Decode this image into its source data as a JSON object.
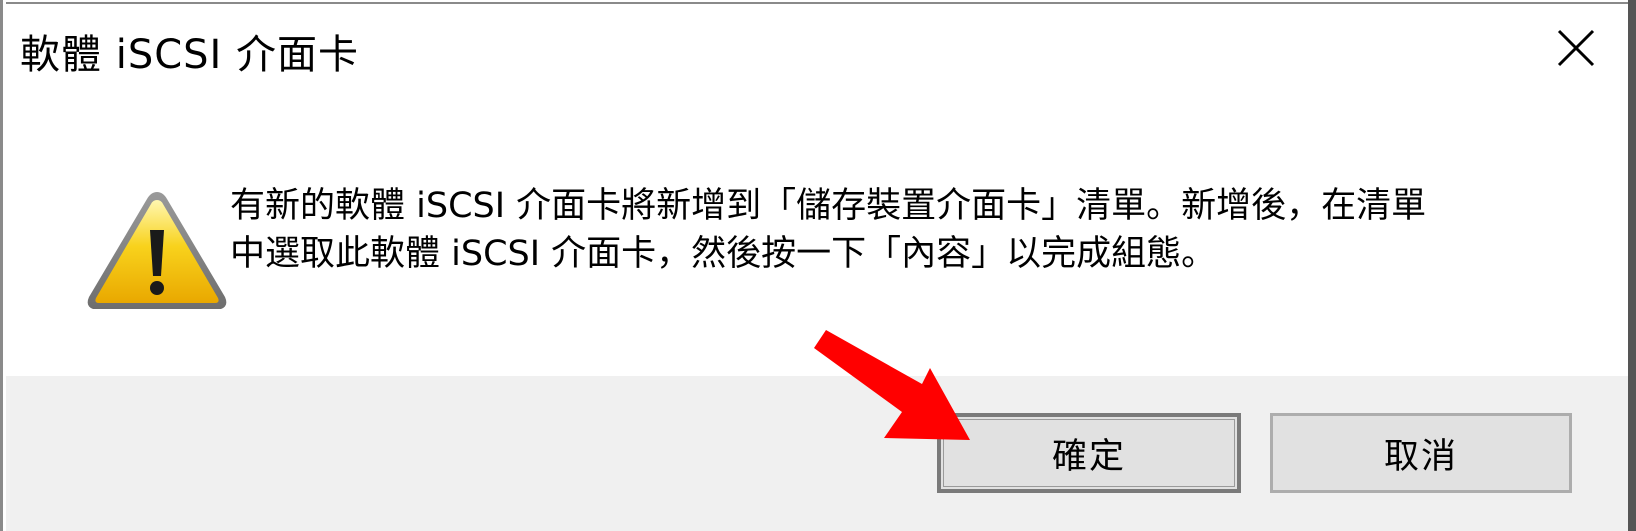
{
  "dialog": {
    "title": "軟體 iSCSI 介面卡",
    "message_line1": "有新的軟體 iSCSI 介面卡將新增到「儲存裝置介面卡」清單。新增後，在清單",
    "message_line2": "中選取此軟體 iSCSI 介面卡，然後按一下「內容」以完成組態。",
    "icon": "warning-icon",
    "close_icon": "close-icon"
  },
  "buttons": {
    "ok_label": "確定",
    "cancel_label": "取消"
  },
  "annotation": {
    "arrow_color": "#ff0000"
  },
  "colors": {
    "footer_bg": "#f0f0f0",
    "button_bg": "#e1e1e1",
    "warning_yellow": "#f5c400"
  }
}
